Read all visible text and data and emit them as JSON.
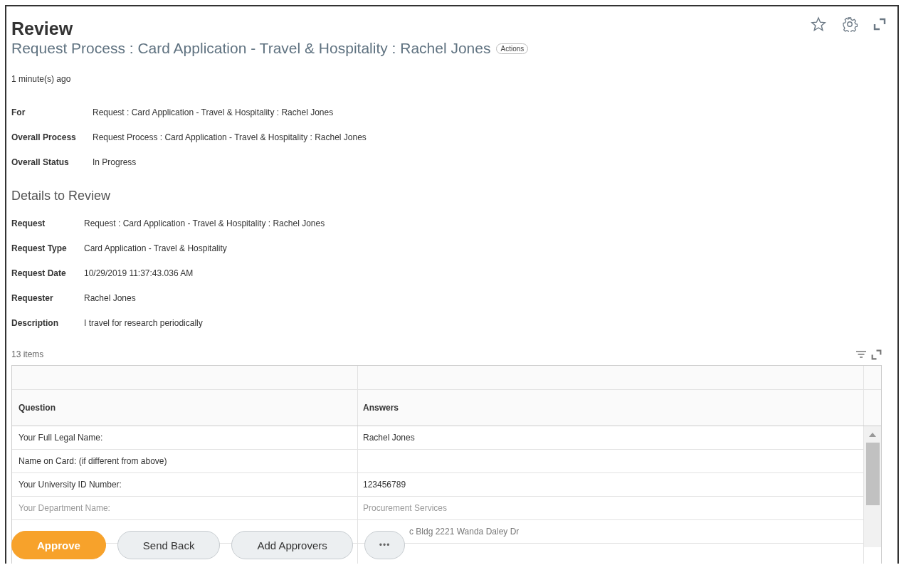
{
  "header": {
    "title": "Review",
    "subtitle": "Request Process : Card Application - Travel & Hospitality : Rachel Jones",
    "actions_label": "Actions",
    "time": "1 minute(s) ago"
  },
  "summary": [
    {
      "label": "For",
      "value": "Request : Card Application - Travel & Hospitality : Rachel Jones"
    },
    {
      "label": "Overall Process",
      "value": "Request Process : Card Application - Travel & Hospitality : Rachel Jones"
    },
    {
      "label": "Overall Status",
      "value": "In Progress"
    }
  ],
  "details": {
    "heading": "Details to Review",
    "fields": [
      {
        "label": "Request",
        "value": "Request : Card Application - Travel & Hospitality : Rachel Jones"
      },
      {
        "label": "Request Type",
        "value": "Card Application - Travel & Hospitality"
      },
      {
        "label": "Request Date",
        "value": "10/29/2019 11:37:43.036 AM"
      },
      {
        "label": "Requester",
        "value": "Rachel Jones"
      },
      {
        "label": "Description",
        "value": "I travel for research periodically"
      }
    ]
  },
  "table": {
    "count": "13 items",
    "columns": [
      "Question",
      "Answers"
    ],
    "rows": [
      {
        "question": "Your Full Legal Name:",
        "answer": "Rachel Jones"
      },
      {
        "question": "Name on Card: (if different from above)",
        "answer": ""
      },
      {
        "question": "Your University ID Number:",
        "answer": "123456789"
      },
      {
        "question": "Your Department Name:",
        "answer": "Procurement Services"
      },
      {
        "question": "",
        "answer": "c Bldg 2221 Wanda Daley Dr"
      }
    ]
  },
  "buttons": [
    {
      "label": "Approve",
      "kind": "primary"
    },
    {
      "label": "Send Back",
      "kind": "secondary"
    },
    {
      "label": "Add Approvers",
      "kind": "secondary"
    },
    {
      "label": "•••",
      "kind": "more"
    }
  ]
}
